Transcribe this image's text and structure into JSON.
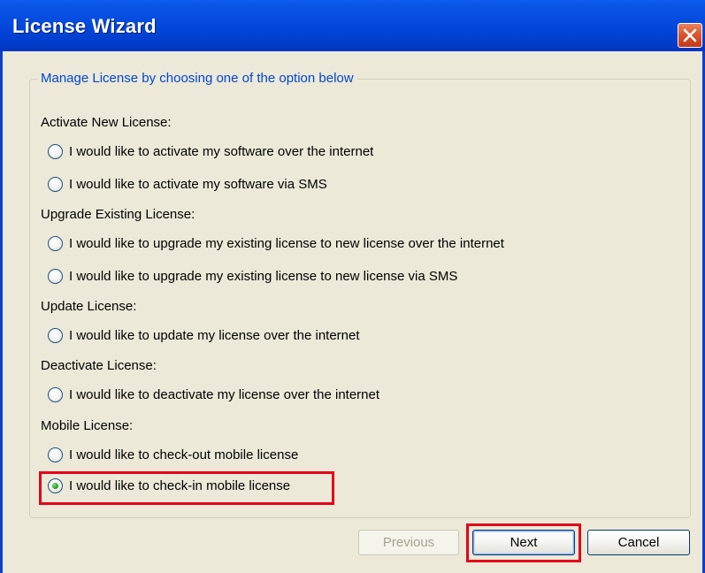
{
  "window": {
    "title": "License Wizard",
    "close_icon": "close-x-icon"
  },
  "group": {
    "legend": "Manage License by choosing one of the option below"
  },
  "sections": {
    "activate": {
      "label": "Activate New License:",
      "options": [
        {
          "label": "I would like to activate my software over the internet",
          "selected": false
        },
        {
          "label": "I would like to activate my software via SMS",
          "selected": false
        }
      ]
    },
    "upgrade": {
      "label": "Upgrade Existing License:",
      "options": [
        {
          "label": "I would like to upgrade my existing license to new license over the internet",
          "selected": false
        },
        {
          "label": "I would like to upgrade my existing license to new license via SMS",
          "selected": false
        }
      ]
    },
    "update": {
      "label": "Update License:",
      "options": [
        {
          "label": "I would like to update my license over the internet",
          "selected": false
        }
      ]
    },
    "deactivate": {
      "label": "Deactivate License:",
      "options": [
        {
          "label": "I would like to deactivate my license over the internet",
          "selected": false
        }
      ]
    },
    "mobile": {
      "label": "Mobile License:",
      "options": [
        {
          "label": "I would like to check-out mobile license",
          "selected": false
        },
        {
          "label": "I would like to check-in mobile license",
          "selected": true
        }
      ]
    }
  },
  "buttons": {
    "previous": {
      "label": "Previous",
      "enabled": false
    },
    "next": {
      "label": "Next",
      "enabled": true
    },
    "cancel": {
      "label": "Cancel",
      "enabled": true
    }
  },
  "colors": {
    "title_bar": "#0145d8",
    "highlight": "#e3001b",
    "legend_text": "#0046d5",
    "radio_selected": "#21a121"
  }
}
